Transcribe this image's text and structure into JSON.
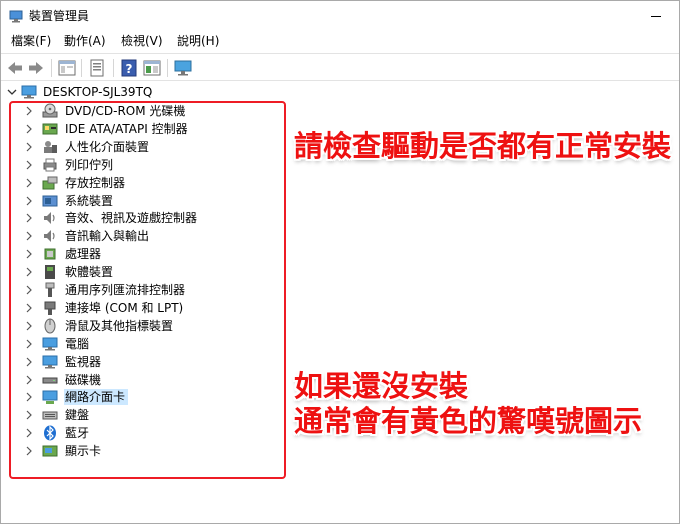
{
  "window": {
    "title": "裝置管理員"
  },
  "menu": [
    "檔案(F)",
    "動作(A)",
    "檢視(V)",
    "說明(H)"
  ],
  "toolbar": {
    "icons": [
      "back-icon",
      "forward-icon",
      "view-icon",
      "properties-icon",
      "help-icon",
      "view2-icon",
      "scan-hardware-icon"
    ]
  },
  "tree": {
    "root": "DESKTOP-SJL39TQ",
    "categories": [
      {
        "label": "DVD/CD-ROM 光碟機",
        "icon": "dvd-drive-icon"
      },
      {
        "label": "IDE ATA/ATAPI 控制器",
        "icon": "ide-controller-icon"
      },
      {
        "label": "人性化介面裝置",
        "icon": "hid-icon"
      },
      {
        "label": "列印佇列",
        "icon": "print-queue-icon"
      },
      {
        "label": "存放控制器",
        "icon": "storage-controller-icon"
      },
      {
        "label": "系統裝置",
        "icon": "system-device-icon"
      },
      {
        "label": "音效、視訊及遊戲控制器",
        "icon": "sound-icon"
      },
      {
        "label": "音訊輸入與輸出",
        "icon": "audio-io-icon"
      },
      {
        "label": "處理器",
        "icon": "processor-icon"
      },
      {
        "label": "軟體裝置",
        "icon": "software-device-icon"
      },
      {
        "label": "通用序列匯流排控制器",
        "icon": "usb-icon"
      },
      {
        "label": "連接埠 (COM 和 LPT)",
        "icon": "port-icon"
      },
      {
        "label": "滑鼠及其他指標裝置",
        "icon": "mouse-icon"
      },
      {
        "label": "電腦",
        "icon": "computer-icon"
      },
      {
        "label": "監視器",
        "icon": "monitor-icon"
      },
      {
        "label": "磁碟機",
        "icon": "disk-drive-icon"
      },
      {
        "label": "網路介面卡",
        "icon": "network-adapter-icon",
        "selected": true
      },
      {
        "label": "鍵盤",
        "icon": "keyboard-icon"
      },
      {
        "label": "藍牙",
        "icon": "bluetooth-icon"
      },
      {
        "label": "顯示卡",
        "icon": "display-adapter-icon"
      }
    ]
  },
  "annotations": {
    "top": "請檢查驅動是否都有正常安裝",
    "bottom_line1": "如果還沒安裝",
    "bottom_line2": "通常會有黃色的驚嘆號圖示"
  },
  "colors": {
    "annotation_red": "#ee1111",
    "selection": "#cce8ff"
  }
}
